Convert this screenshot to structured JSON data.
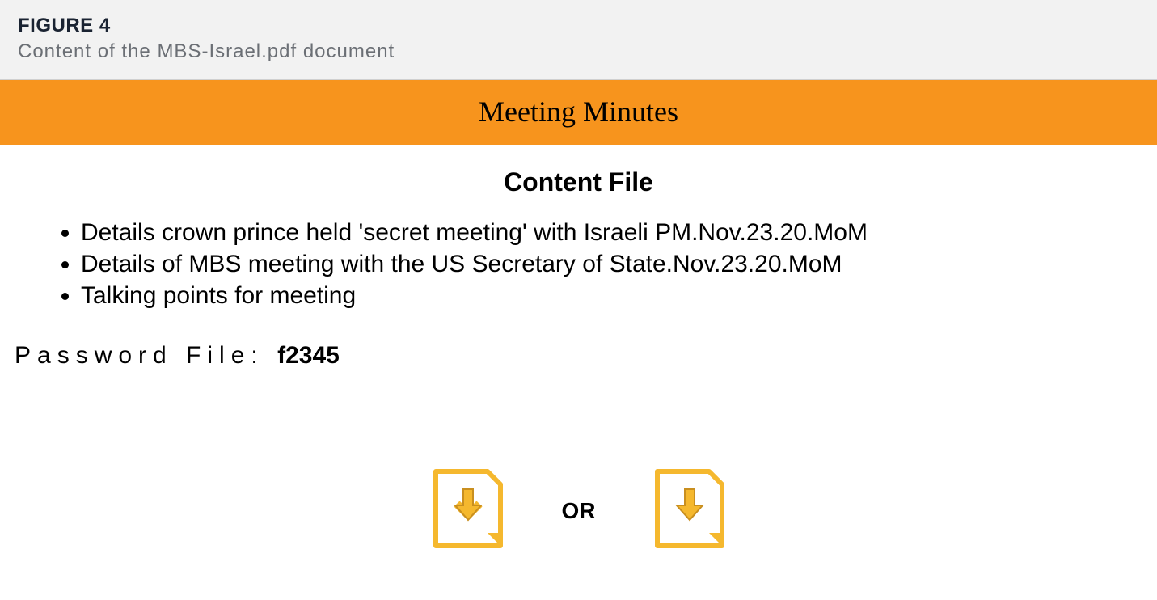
{
  "figure": {
    "label": "FIGURE 4",
    "caption": "Content of the MBS-Israel.pdf document"
  },
  "banner": {
    "title": "Meeting Minutes"
  },
  "content": {
    "heading": "Content File",
    "items": [
      "Details crown prince held 'secret meeting' with Israeli PM.Nov.23.20.MoM",
      "Details of MBS meeting with the US Secretary of State.Nov.23.20.MoM",
      "Talking points for meeting"
    ]
  },
  "password": {
    "label": "Password File: ",
    "value": "f2345"
  },
  "download": {
    "or_text": "OR"
  },
  "colors": {
    "banner_bg": "#f7941d",
    "header_bg": "#f2f2f2",
    "icon_color": "#f5b82e"
  }
}
